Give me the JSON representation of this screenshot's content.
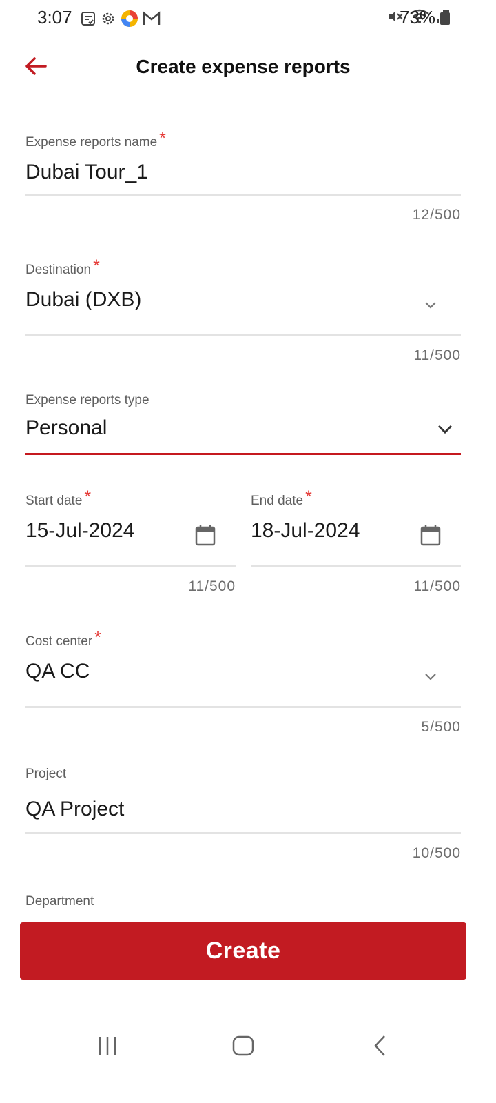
{
  "status_bar": {
    "time": "3:07",
    "battery": "73%",
    "left_icons": [
      "notes-icon",
      "settings-icon",
      "app-icon",
      "gmail-icon"
    ],
    "right_icons": [
      "mute-icon",
      "wifi-icon",
      "signal-icon",
      "battery-icon"
    ]
  },
  "app_bar": {
    "title": "Create expense reports",
    "back_icon": "back-arrow-icon"
  },
  "form": {
    "report_name": {
      "label": "Expense reports name",
      "required_mark": "*",
      "value": "Dubai Tour_1",
      "counter": "12/500"
    },
    "destination": {
      "label": "Destination",
      "required_mark": "*",
      "value": "Dubai (DXB)",
      "counter": "11/500"
    },
    "report_type": {
      "label": "Expense reports type",
      "value": "Personal"
    },
    "start_date": {
      "label": "Start date",
      "required_mark": "*",
      "value": "15-Jul-2024",
      "counter": "11/500"
    },
    "end_date": {
      "label": "End date",
      "required_mark": "*",
      "value": "18-Jul-2024",
      "counter": "11/500"
    },
    "cost_center": {
      "label": "Cost center",
      "required_mark": "*",
      "value": "QA CC",
      "counter": "5/500"
    },
    "project": {
      "label": "Project",
      "value": "QA Project",
      "counter": "10/500"
    },
    "department": {
      "label": "Department"
    }
  },
  "create_button": {
    "label": "Create"
  },
  "colors": {
    "accent": "#c21b22",
    "required": "#e53935",
    "label": "#5f5f5f",
    "divider": "#e3e3e3"
  },
  "nav_bar": {
    "icons": [
      "recent-apps-icon",
      "home-icon",
      "back-icon"
    ]
  }
}
